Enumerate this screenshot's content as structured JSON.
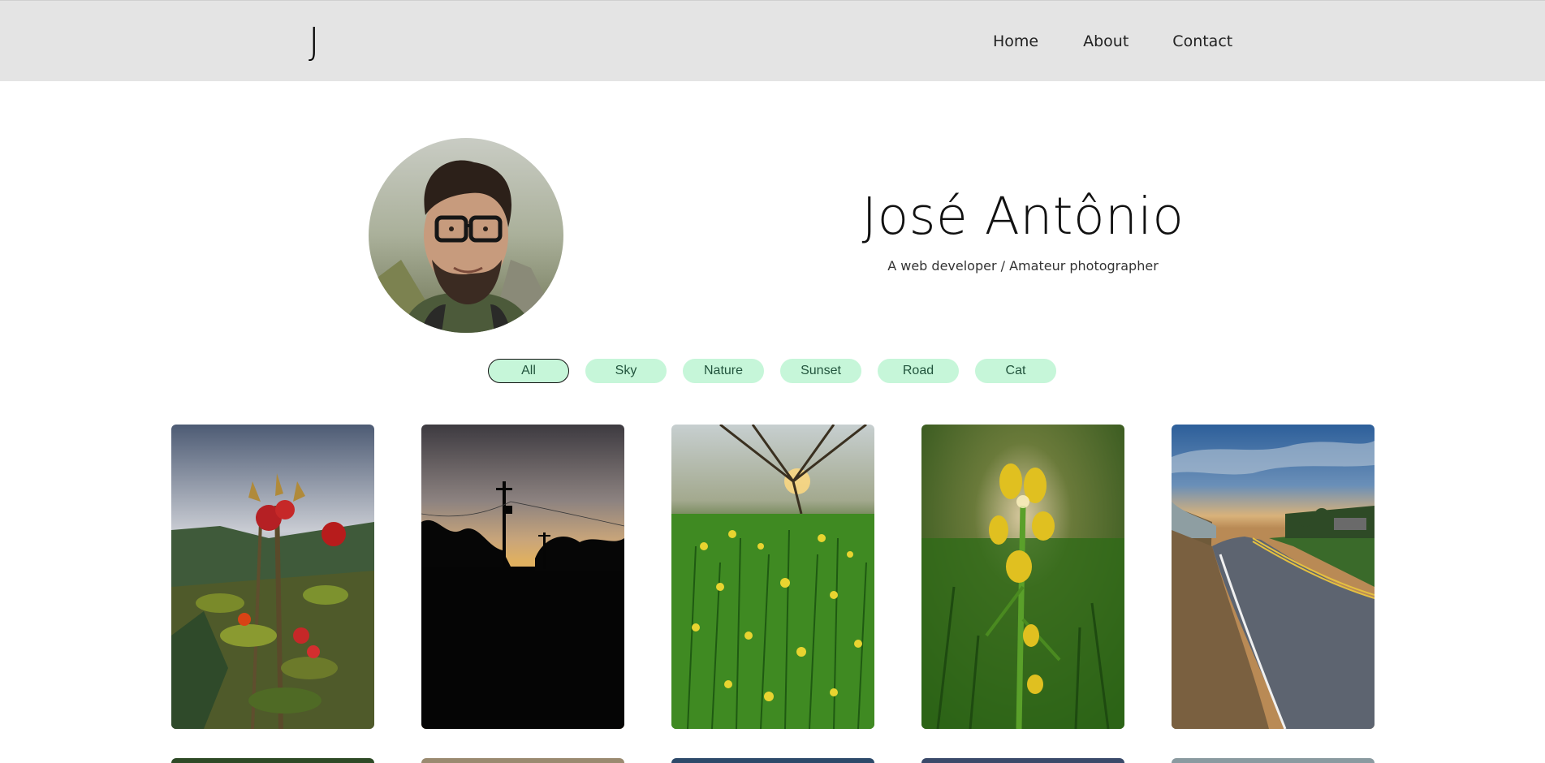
{
  "header": {
    "logo": "J",
    "nav": [
      {
        "label": "Home"
      },
      {
        "label": "About"
      },
      {
        "label": "Contact"
      }
    ]
  },
  "profile": {
    "name": "José Antônio",
    "tagline": "A web developer / Amateur photographer"
  },
  "filters": [
    {
      "label": "All",
      "active": true
    },
    {
      "label": "Sky",
      "active": false
    },
    {
      "label": "Nature",
      "active": false
    },
    {
      "label": "Sunset",
      "active": false
    },
    {
      "label": "Road",
      "active": false
    },
    {
      "label": "Cat",
      "active": false
    }
  ],
  "colors": {
    "header_bg": "#e4e4e4",
    "chip_bg": "#c6f6d9",
    "chip_text": "#22543d"
  }
}
